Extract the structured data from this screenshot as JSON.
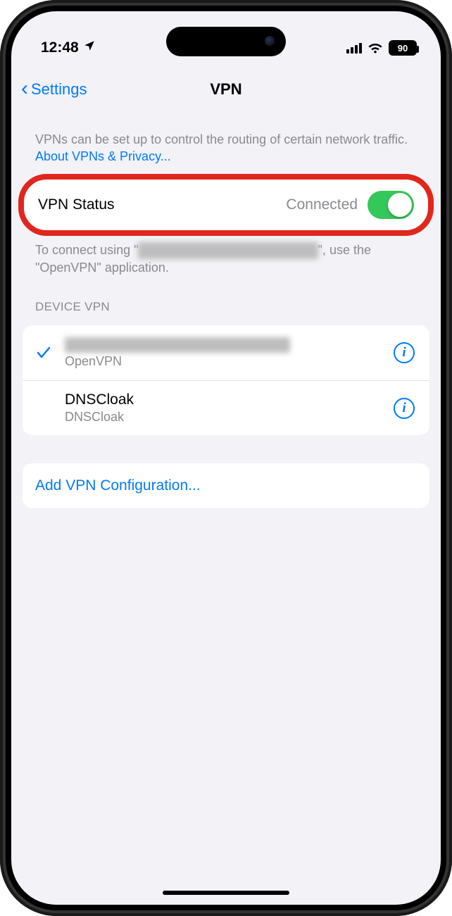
{
  "status_bar": {
    "time": "12:48",
    "battery": "90"
  },
  "navbar": {
    "back_label": "Settings",
    "title": "VPN"
  },
  "intro": {
    "text": "VPNs can be set up to control the routing of certain network traffic. ",
    "link_text": "About VPNs & Privacy..."
  },
  "vpn_status": {
    "label": "VPN Status",
    "value": "Connected",
    "enabled": true
  },
  "connect_hint": {
    "prefix": "To connect using \"",
    "redacted": "████████████████████",
    "suffix": "\", use the \"OpenVPN\" application."
  },
  "device_vpn": {
    "header": "DEVICE VPN",
    "items": [
      {
        "selected": true,
        "name_redacted": true,
        "name": "",
        "provider": "OpenVPN"
      },
      {
        "selected": false,
        "name_redacted": false,
        "name": "DNSCloak",
        "provider": "DNSCloak"
      }
    ]
  },
  "add_config": {
    "label": "Add VPN Configuration..."
  }
}
